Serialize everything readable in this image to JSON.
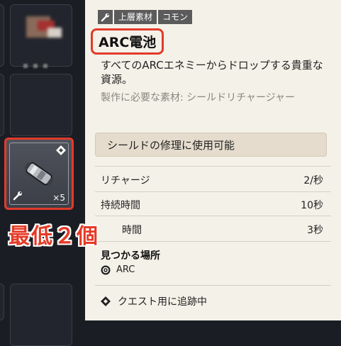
{
  "inventory": {
    "item_quantity": "×5",
    "minimum_label": "最低２個"
  },
  "tooltip": {
    "tags": [
      "上層素材",
      "コモン"
    ],
    "title": "ARC電池",
    "description": "すべてのARCエネミーからドロップする貴重な資源。",
    "crafting": "製作に必要な素材: シールドリチャージャー",
    "capability": "シールドの修理に使用可能",
    "stats": [
      {
        "label": "リチャージ",
        "value": "2/秒"
      },
      {
        "label": "持続時間",
        "value": "10秒"
      },
      {
        "label": "時間",
        "value": "3秒"
      }
    ],
    "found_heading": "見つかる場所",
    "found_location": "ARC",
    "quest_status": "クエスト用に追跡中"
  },
  "colors": {
    "highlight": "#e23b2a",
    "panel_bg": "#f4f1e8",
    "inventory_bg": "#1b1d24"
  }
}
